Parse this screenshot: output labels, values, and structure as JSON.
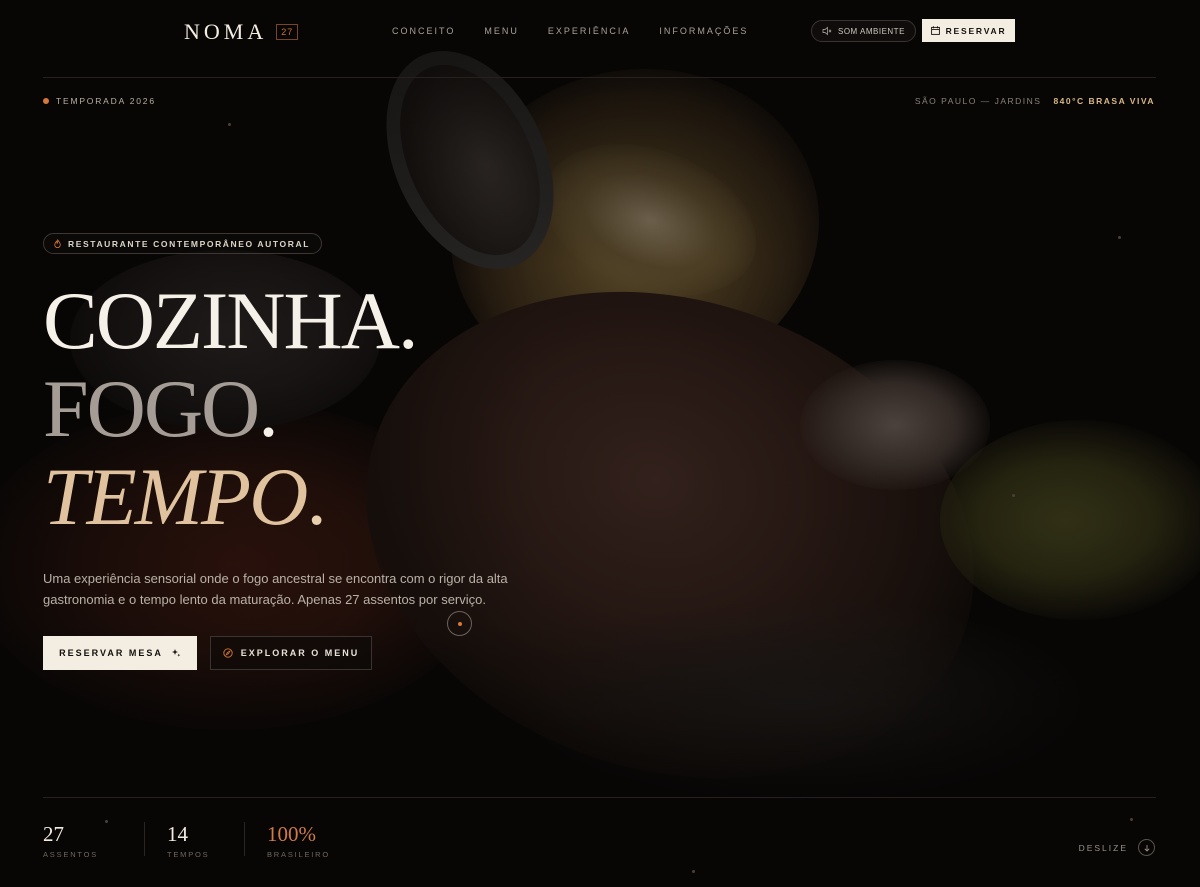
{
  "brand": {
    "name": "NOMA",
    "badge": "27"
  },
  "nav": {
    "items": [
      "CONCEITO",
      "MENU",
      "EXPERIÊNCIA",
      "INFORMAÇÕES"
    ]
  },
  "header": {
    "sound_label": "SOM AMBIENTE",
    "reserve_label": "RESERVAR"
  },
  "meta": {
    "season": "TEMPORADA 2026",
    "location": "SÃO PAULO — JARDINS",
    "temperature": "840°C BRASA VIVA"
  },
  "hero": {
    "tag": "RESTAURANTE CONTEMPORÂNEO AUTORAL",
    "line1": "COZINHA",
    "line2": "FOGO",
    "line3": "TEMPO",
    "period": ".",
    "lede": "Uma experiência sensorial onde o fogo ancestral se encontra com o rigor da alta gastronomia e o tempo lento da maturação. Apenas 27 assentos por serviço.",
    "cta_primary": "RESERVAR MESA",
    "cta_secondary": "EXPLORAR O MENU"
  },
  "stats": [
    {
      "value": "27",
      "label": "ASSENTOS"
    },
    {
      "value": "14",
      "label": "TEMPOS"
    },
    {
      "value": "100%",
      "label": "BRASILEIRO"
    }
  ],
  "scroll_hint": "DESLIZE",
  "colors": {
    "background": "#0a0807",
    "accent": "#d5783c",
    "cream": "#f3ede2",
    "gold": "#e0c29e"
  }
}
